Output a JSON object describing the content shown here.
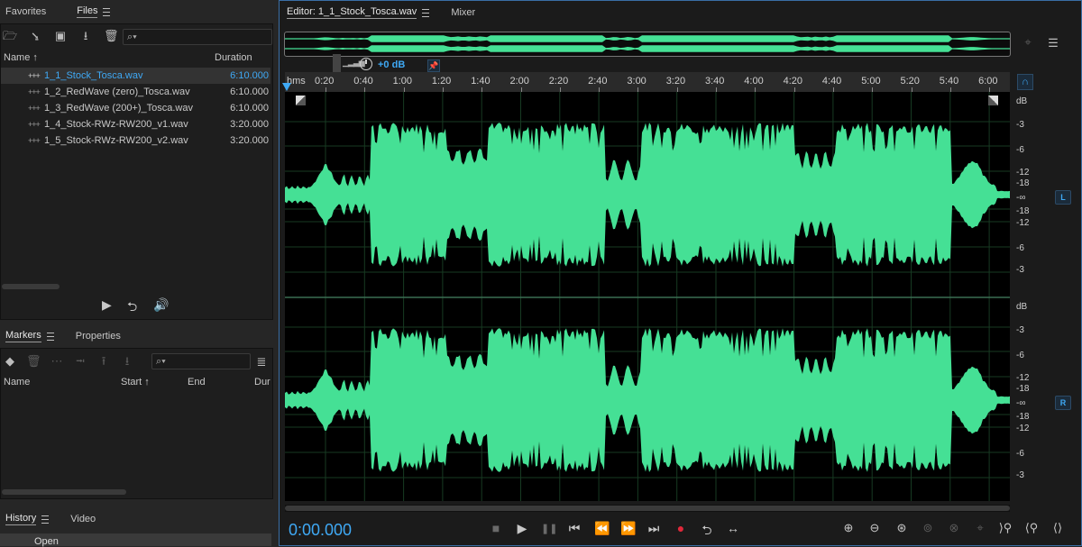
{
  "files_panel": {
    "tabs": [
      {
        "label": "Favorites"
      },
      {
        "label": "Files"
      }
    ],
    "columns": {
      "name": "Name",
      "duration": "Duration"
    },
    "rows": [
      {
        "name": "1_1_Stock_Tosca.wav",
        "duration": "6:10.000"
      },
      {
        "name": "1_2_RedWave (zero)_Tosca.wav",
        "duration": "6:10.000"
      },
      {
        "name": "1_3_RedWave (200+)_Tosca.wav",
        "duration": "6:10.000"
      },
      {
        "name": "1_4_Stock-RWz-RW200_v1.wav",
        "duration": "3:20.000"
      },
      {
        "name": "1_5_Stock-RWz-RW200_v2.wav",
        "duration": "3:20.000"
      }
    ],
    "search_placeholder": "⌕▾"
  },
  "markers_panel": {
    "tabs": [
      {
        "label": "Markers"
      },
      {
        "label": "Properties"
      }
    ],
    "columns": {
      "name": "Name",
      "start": "Start",
      "end": "End",
      "dur": "Dur"
    },
    "search_placeholder": "⌕▾"
  },
  "history_panel": {
    "tabs": [
      {
        "label": "History"
      },
      {
        "label": "Video"
      }
    ],
    "first_item": "Open"
  },
  "editor": {
    "tabs": [
      {
        "label": "Editor: 1_1_Stock_Tosca.wav"
      },
      {
        "label": "Mixer"
      }
    ],
    "gain": "+0 dB",
    "ruler": {
      "unit": "hms",
      "labels": [
        "0:20",
        "0:40",
        "1:00",
        "1:20",
        "1:40",
        "2:00",
        "2:20",
        "2:40",
        "3:00",
        "3:20",
        "3:40",
        "4:00",
        "4:20",
        "4:40",
        "5:00",
        "5:20",
        "5:40",
        "6:00"
      ]
    },
    "db_scale": {
      "unit": "dB",
      "marks": [
        "-3",
        "-6",
        "-12",
        "-18",
        "-∞",
        "-18",
        "-12",
        "-6",
        "-3"
      ]
    },
    "channels": {
      "left": "L",
      "right": "R"
    },
    "time": "0:00.000"
  },
  "colors": {
    "waveform": "#45e095",
    "accent": "#3fa9f5",
    "grid": "#1e4a2e",
    "bg": "#000000"
  },
  "icons": {
    "folder": "🗁",
    "play": "▶",
    "stop": "■",
    "pause": "❚❚",
    "record": "●"
  }
}
